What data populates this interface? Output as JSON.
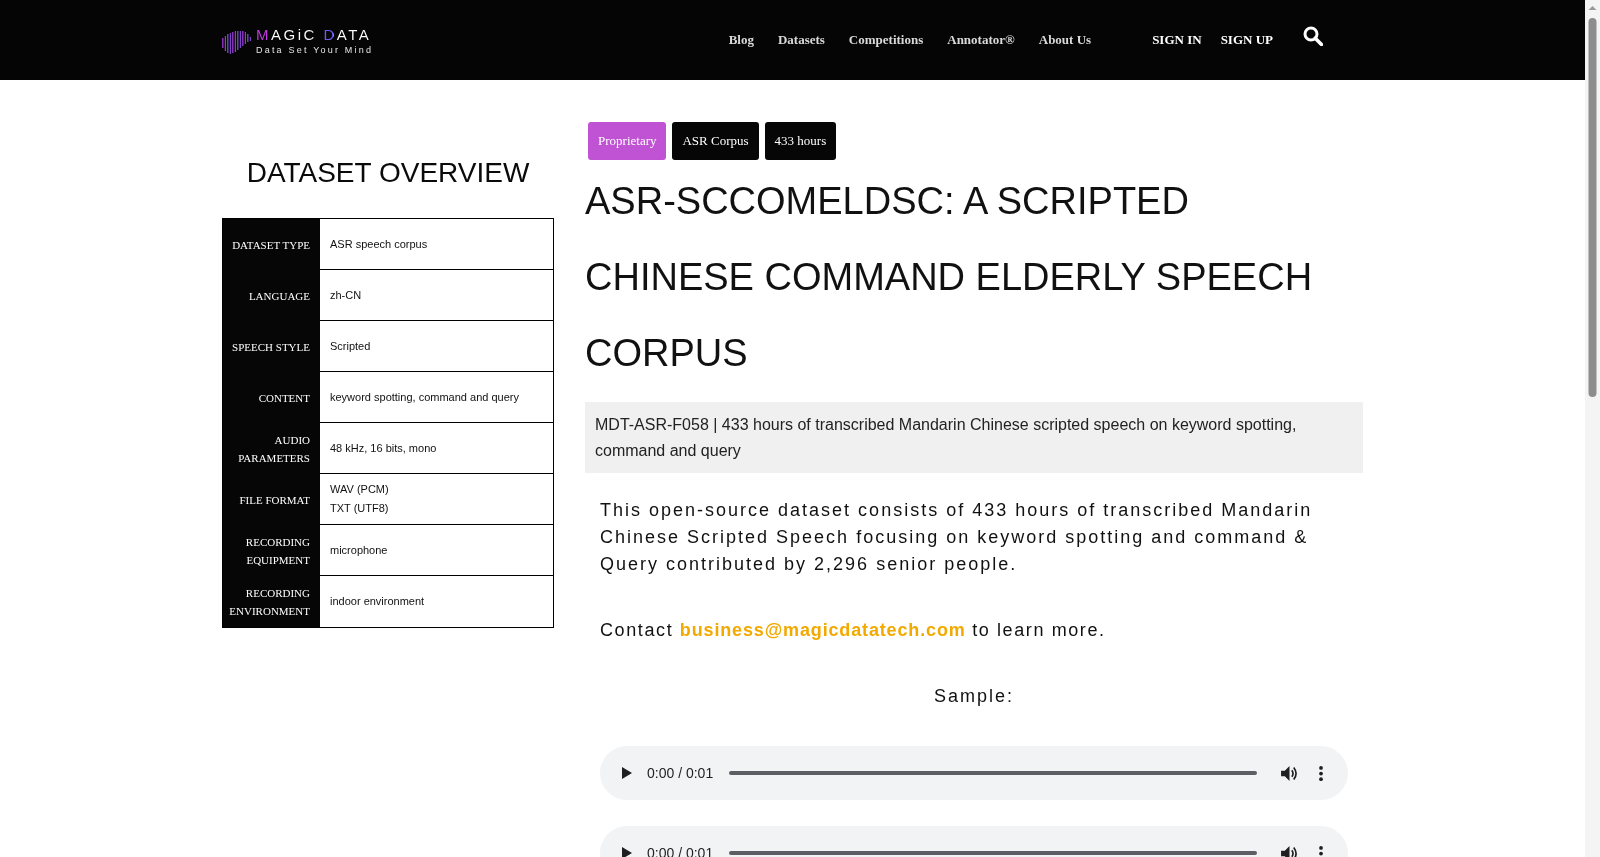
{
  "header": {
    "logo": {
      "name": "MAGiC DATA",
      "tagline": "Data Set Your Mind"
    },
    "nav": [
      "Blog",
      "Datasets",
      "Competitions",
      "Annotator®",
      "About Us"
    ],
    "account_links": [
      "SIGN IN",
      "SIGN UP"
    ]
  },
  "overview": {
    "title": "DATASET OVERVIEW",
    "rows": [
      {
        "label": "DATASET TYPE",
        "values": [
          "ASR speech corpus"
        ]
      },
      {
        "label": "LANGUAGE",
        "values": [
          "zh-CN"
        ]
      },
      {
        "label": "SPEECH STYLE",
        "values": [
          "Scripted"
        ]
      },
      {
        "label": "CONTENT",
        "values": [
          "keyword spotting, command and query"
        ]
      },
      {
        "label": "AUDIO PARAMETERS",
        "values": [
          "48 kHz, 16 bits, mono"
        ]
      },
      {
        "label": "FILE FORMAT",
        "values": [
          "WAV (PCM)",
          "TXT (UTF8)"
        ]
      },
      {
        "label": "RECORDING EQUIPMENT",
        "values": [
          "microphone"
        ]
      },
      {
        "label": "RECORDING ENVIRONMENT",
        "values": [
          "indoor environment"
        ]
      }
    ]
  },
  "dataset": {
    "tags": [
      {
        "label": "Proprietary",
        "color": "#c052d4"
      },
      {
        "label": "ASR Corpus",
        "color": "#060606"
      },
      {
        "label": "433 hours",
        "color": "#060606"
      }
    ],
    "title": "ASR-SCCOMELDSC: A SCRIPTED CHINESE COMMAND ELDERLY SPEECH CORPUS",
    "summary": "MDT-ASR-F058 | 433 hours of transcribed Mandarin Chinese scripted speech on keyword spotting, command and query",
    "description": "This open-source dataset consists of 433 hours of transcribed Mandarin Chinese Scripted Speech focusing on keyword spotting and command & Query contributed by 2,296 senior people.",
    "contact": {
      "before": "Contact",
      "email": "business@magicdatatech.com",
      "after": "to learn more."
    },
    "sample_label": "Sample:",
    "audio_players": [
      {
        "time": "0:00 / 0:01"
      },
      {
        "time": "0:00 / 0:01"
      }
    ]
  }
}
